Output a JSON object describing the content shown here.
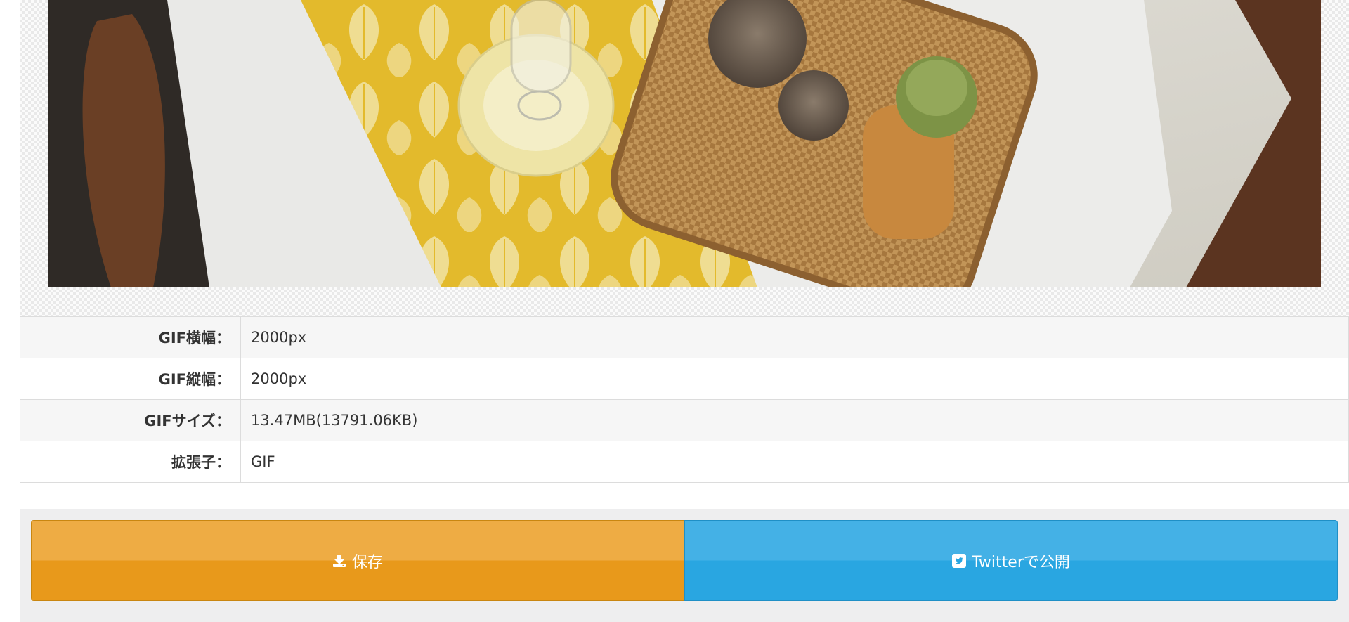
{
  "preview": {
    "alt": "Still life photo: yellow leaf-pattern table runner, wine glass on a yellow saucer, wicker tray with pine cones and a green candle in a wooden holder"
  },
  "info": {
    "rows": [
      {
        "label": "GIF横幅：",
        "value": "2000px"
      },
      {
        "label": "GIF縦幅：",
        "value": "2000px"
      },
      {
        "label": "GIFサイズ：",
        "value": "13.47MB(13791.06KB)"
      },
      {
        "label": "拡張子：",
        "value": "GIF"
      }
    ]
  },
  "actions": {
    "save": {
      "label": "保存",
      "icon": "download-icon",
      "color": "#e8991b"
    },
    "twitter": {
      "label": "Twitterで公開",
      "icon": "twitter-square-icon",
      "color": "#29a6e1"
    }
  }
}
